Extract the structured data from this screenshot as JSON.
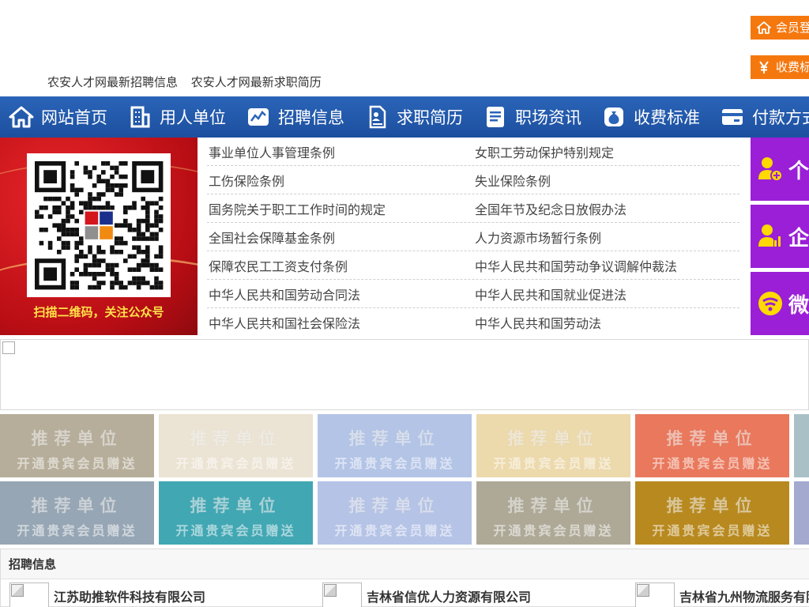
{
  "header": {
    "top_links": [
      "农安人才网最新招聘信息",
      "农安人才网最新求职简历"
    ],
    "login_button": "会员登",
    "fee_button": "收费标"
  },
  "nav": {
    "items": [
      {
        "label": "网站首页",
        "icon": "home-icon"
      },
      {
        "label": "用人单位",
        "icon": "building-icon"
      },
      {
        "label": "招聘信息",
        "icon": "chart-icon"
      },
      {
        "label": "求职简历",
        "icon": "resume-icon"
      },
      {
        "label": "职场资讯",
        "icon": "news-icon"
      },
      {
        "label": "收费标准",
        "icon": "money-bag-icon"
      },
      {
        "label": "付款方式",
        "icon": "card-icon"
      }
    ]
  },
  "qr": {
    "caption": "扫描二维码，关注公众号"
  },
  "laws": [
    [
      "事业单位人事管理条例",
      "女职工劳动保护特别规定"
    ],
    [
      "工伤保险条例",
      "失业保险条例"
    ],
    [
      "国务院关于职工工作时间的规定",
      "全国年节及纪念日放假办法"
    ],
    [
      "全国社会保障基金条例",
      "人力资源市场暂行条例"
    ],
    [
      "保障农民工工资支付条例",
      "中华人民共和国劳动争议调解仲裁法"
    ],
    [
      "中华人民共和国劳动合同法",
      "中华人民共和国就业促进法"
    ],
    [
      "中华人民共和国社会保险法",
      "中华人民共和国劳动法"
    ]
  ],
  "side_tiles": [
    {
      "label": "个",
      "icon": "person-add-icon"
    },
    {
      "label": "企",
      "icon": "person-chart-icon"
    },
    {
      "label": "微",
      "icon": "wechat-icon"
    }
  ],
  "recommended": {
    "title": "推荐单位",
    "subtitle": "开通贵宾会员赠送",
    "colors": [
      "#b6ae9a",
      "#ebe3d3",
      "#b3c4e6",
      "#ecd9ac",
      "#e9785c",
      "#a9c0c6",
      "#97a6b4",
      "#41a7b3",
      "#b5c3e6",
      "#aea997",
      "#b8891f",
      "#a3a9cf"
    ]
  },
  "recruitment": {
    "heading": "招聘信息",
    "companies": [
      "江苏助推软件科技有限公司",
      "吉林省信优人力资源有限公司",
      "吉林省九州物流服务有限公司"
    ]
  }
}
